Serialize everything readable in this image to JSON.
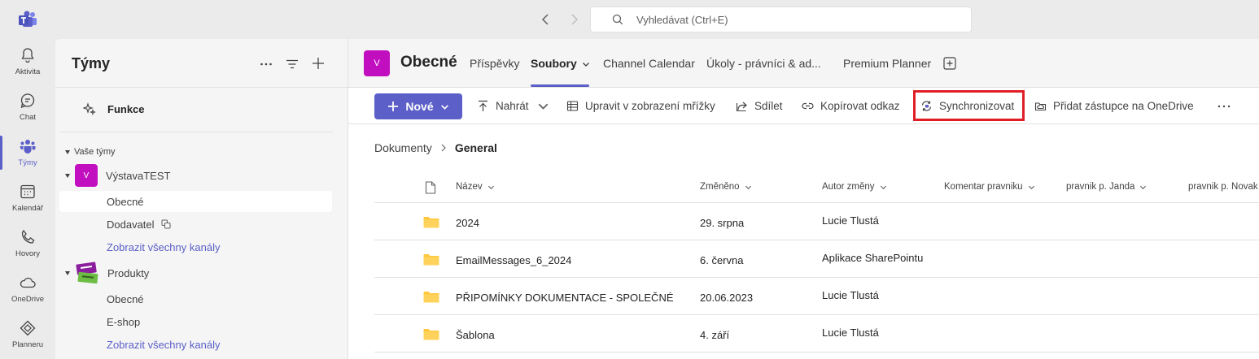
{
  "search": {
    "placeholder": "Vyhledávat (Ctrl+E)"
  },
  "rail": {
    "items": [
      {
        "label": "Aktivita",
        "icon": "bell-icon"
      },
      {
        "label": "Chat",
        "icon": "chat-icon"
      },
      {
        "label": "Týmy",
        "icon": "teams-icon"
      },
      {
        "label": "Kalendář",
        "icon": "calendar-icon"
      },
      {
        "label": "Hovory",
        "icon": "phone-icon"
      },
      {
        "label": "OneDrive",
        "icon": "cloud-icon"
      },
      {
        "label": "Planneru",
        "icon": "planner-icon"
      }
    ],
    "active": "Týmy"
  },
  "teams_panel": {
    "title": "Týmy",
    "funkce": "Funkce",
    "section": "Vaše týmy",
    "teams": [
      {
        "name": "VýstavaTEST",
        "avatar": "V",
        "channels": [
          "Obecné",
          "Dodavatel"
        ],
        "show_all": "Zobrazit všechny kanály"
      },
      {
        "name": "Produkty",
        "channels": [
          "Obecné",
          "E-shop"
        ],
        "show_all": "Zobrazit všechny kanály"
      }
    ]
  },
  "channel": {
    "avatar": "V",
    "name": "Obecné",
    "tabs": [
      "Příspěvky",
      "Soubory",
      "Channel Calendar",
      "Úkoly - právníci & ad...",
      "Premium Planner"
    ],
    "active_tab": "Soubory"
  },
  "toolbar": {
    "new": "Nové",
    "upload": "Nahrát",
    "grid": "Upravit v zobrazení mřížky",
    "share": "Sdílet",
    "copy_link": "Kopírovat odkaz",
    "sync": "Synchronizovat",
    "onedrive": "Přidat zástupce na OneDrive"
  },
  "breadcrumb": {
    "root": "Dokumenty",
    "current": "General"
  },
  "columns": [
    "Název",
    "Změněno",
    "Autor změny",
    "Komentar pravniku",
    "pravnik p. Janda",
    "pravnik p. Novak"
  ],
  "files": [
    {
      "name": "2024",
      "modified": "29. srpna",
      "author": "Lucie Tlustá"
    },
    {
      "name": "EmailMessages_6_2024",
      "modified": "6. června",
      "author": "Aplikace SharePointu"
    },
    {
      "name": "PŘIPOMÍNKY DOKUMENTACE - SPOLEČNÉ",
      "modified": "20.06.2023",
      "author": "Lucie Tlustá"
    },
    {
      "name": "Šablona",
      "modified": "4. září",
      "author": "Lucie Tlustá"
    }
  ],
  "colors": {
    "accent": "#5b5fc7",
    "team_avatar": "#c10fbf",
    "folder": "#ffc83d",
    "highlight": "#e01e26"
  }
}
